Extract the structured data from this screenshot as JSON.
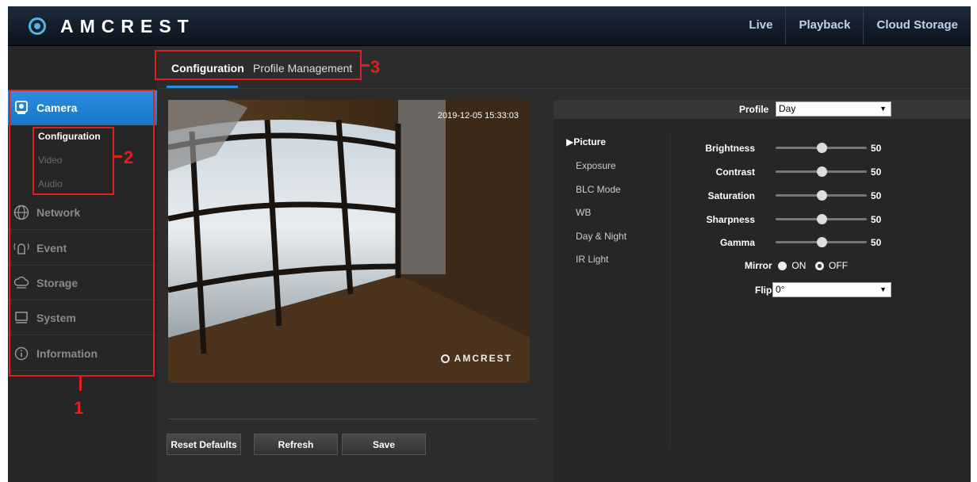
{
  "header": {
    "brand": "AMCREST",
    "nav": [
      "Live",
      "Playback",
      "Cloud Storage"
    ]
  },
  "sidebar": {
    "items": [
      {
        "label": "Camera",
        "icon": "camera-icon",
        "active": true
      },
      {
        "label": "Network",
        "icon": "network-icon"
      },
      {
        "label": "Event",
        "icon": "event-icon"
      },
      {
        "label": "Storage",
        "icon": "storage-icon"
      },
      {
        "label": "System",
        "icon": "system-icon"
      },
      {
        "label": "Information",
        "icon": "info-icon"
      }
    ],
    "subitems": [
      "Configuration",
      "Video",
      "Audio"
    ]
  },
  "tabs": [
    "Configuration",
    "Profile Management"
  ],
  "annotations": [
    "1",
    "2",
    "3"
  ],
  "video": {
    "timestamp": "2019-12-05 15:33:03",
    "watermark": "AMCREST"
  },
  "buttons": {
    "reset": "Reset Defaults",
    "refresh": "Refresh",
    "save": "Save"
  },
  "settings": {
    "profile_label": "Profile",
    "profile_value": "Day",
    "menu": [
      "Picture",
      "Exposure",
      "BLC Mode",
      "WB",
      "Day & Night",
      "IR Light"
    ],
    "sliders": [
      {
        "label": "Brightness",
        "value": "50",
        "level": 0.5
      },
      {
        "label": "Contrast",
        "value": "50",
        "level": 0.5
      },
      {
        "label": "Saturation",
        "value": "50",
        "level": 0.5
      },
      {
        "label": "Sharpness",
        "value": "50",
        "level": 0.5
      },
      {
        "label": "Gamma",
        "value": "50",
        "level": 0.5
      }
    ],
    "mirror": {
      "label": "Mirror",
      "on": "ON",
      "off": "OFF",
      "selected": "OFF"
    },
    "flip": {
      "label": "Flip",
      "value": "0°"
    }
  },
  "colors": {
    "accent": "#1a7ccc",
    "annotation": "#e0201e"
  }
}
